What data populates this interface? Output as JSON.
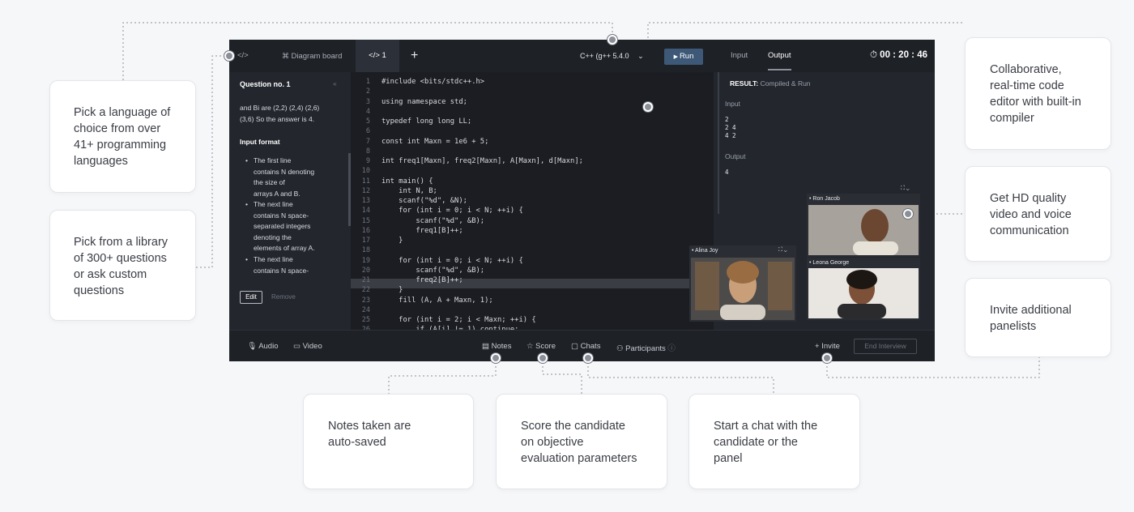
{
  "cards": {
    "language": [
      "Pick a language of",
      "choice from over",
      "41+ programming",
      "languages"
    ],
    "library": [
      "Pick from a library",
      "of 300+ questions",
      "or ask custom",
      "questions"
    ],
    "editor": [
      "Collaborative,",
      "real-time code",
      "editor with built-in",
      "compiler"
    ],
    "video": [
      "Get HD quality",
      "video and voice",
      "communication"
    ],
    "invite": [
      "Invite additional",
      "panelists"
    ],
    "notes": [
      "Notes taken are",
      "auto-saved"
    ],
    "score": [
      "Score the candidate",
      "on objective",
      "evaluation parameters"
    ],
    "chat": [
      "Start a chat with the",
      "candidate or the",
      "panel"
    ]
  },
  "ide": {
    "tabs": {
      "code_icon": "</>",
      "diagram": "Diagram board",
      "active": "</> 1",
      "add": "+"
    },
    "language_select": "C++ (g++ 5.4.0",
    "run_label": "Run",
    "right_tabs": {
      "input": "Input",
      "output": "Output"
    },
    "timer": "00 : 20 : 46",
    "question": {
      "title": "Question no. 1",
      "para1": [
        "and Bi are (2,2) (2,4) (2,6)",
        "(3,6)  So the answer is 4."
      ],
      "input_format": "Input format",
      "bullets": [
        [
          "The first line",
          "contains N denoting",
          "the size of",
          "arrays A and B."
        ],
        [
          "The next line",
          "contains N space-",
          "separated integers",
          "denoting the",
          "elements of array A."
        ],
        [
          "The next line",
          "contains N space-"
        ]
      ],
      "edit": "Edit",
      "remove": "Remove"
    },
    "code_lines": [
      "#include <bits/stdc++.h>",
      "",
      "using namespace std;",
      "",
      "typedef long long LL;",
      "",
      "const int Maxn = 1e6 + 5;",
      "",
      "int freq1[Maxn], freq2[Maxn], A[Maxn], d[Maxn];",
      "",
      "int main() {",
      "    int N, B;",
      "    scanf(\"%d\", &N);",
      "    for (int i = 0; i < N; ++i) {",
      "        scanf(\"%d\", &B);",
      "        freq1[B]++;",
      "    }",
      "",
      "    for (int i = 0; i < N; ++i) {",
      "        scanf(\"%d\", &B);",
      "        freq2[B]++;",
      "    }",
      "    fill (A, A + Maxn, 1);",
      "",
      "    for (int i = 2; i < Maxn; ++i) {",
      "        if (A[i] != 1) continue;"
    ],
    "result": {
      "label": "RESULT:",
      "status": "Compiled & Run",
      "input_label": "Input",
      "input_values": [
        "2",
        "2 4",
        "4 2"
      ],
      "output_label": "Output",
      "output_value": "4"
    },
    "videos": {
      "alina": "Alina Joy",
      "ron": "Ron Jacob",
      "leona": "Leona George"
    },
    "bottom": {
      "audio": "Audio",
      "video": "Video",
      "notes": "Notes",
      "score": "Score",
      "chats": "Chats",
      "participants": "Participants",
      "invite": "+ Invite",
      "end": "End Interview"
    }
  }
}
